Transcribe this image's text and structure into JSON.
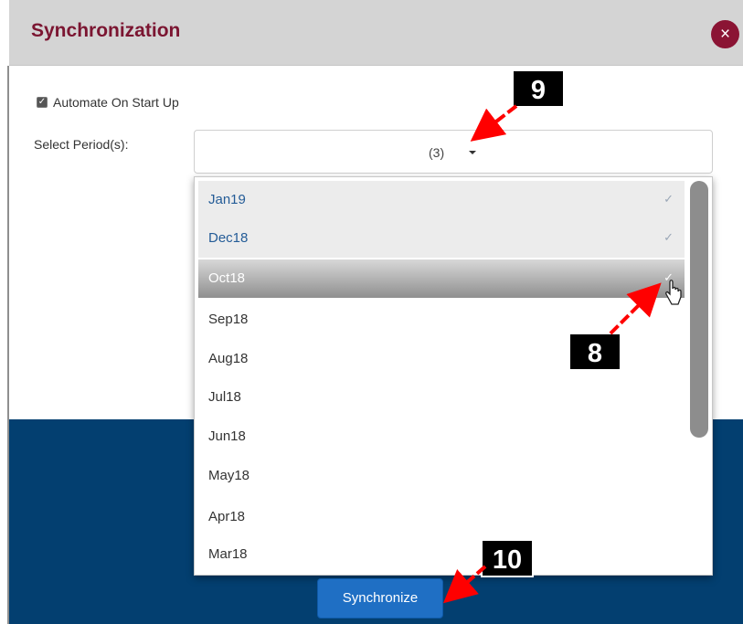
{
  "dialog": {
    "title": "Synchronization",
    "close_icon": "×",
    "automate_label": "Automate On Start Up",
    "automate_checked": true,
    "period_label": "Select Period(s):",
    "selected_summary": "(3)",
    "synchronize_label": "Synchronize"
  },
  "dropdown": {
    "check_icon": "✓",
    "items": [
      {
        "label": "Jan19",
        "checked": true
      },
      {
        "label": "Dec18",
        "checked": true
      },
      {
        "label": "Oct18",
        "checked": true
      },
      {
        "label": "Sep18",
        "checked": false
      },
      {
        "label": "Aug18",
        "checked": false
      },
      {
        "label": "Jul18",
        "checked": false
      },
      {
        "label": "Jun18",
        "checked": false
      },
      {
        "label": "May18",
        "checked": false
      },
      {
        "label": "Apr18",
        "checked": false
      },
      {
        "label": "Mar18",
        "checked": false
      }
    ]
  },
  "annotations": {
    "step_9": "9",
    "step_8": "8",
    "step_10": "10"
  },
  "colors": {
    "title": "#7b1531",
    "close_button": "#8b1434",
    "footer": "#033f70",
    "button": "#1f6fc4",
    "selected_text": "#245c97",
    "annotation_arrow": "#ff0000"
  },
  "icons": {
    "close": "close-icon",
    "checkbox": "checkbox-icon",
    "caret": "caret-down-icon",
    "check": "check-icon",
    "cursor": "hand-cursor-icon",
    "arrow": "red-arrow-icon"
  }
}
